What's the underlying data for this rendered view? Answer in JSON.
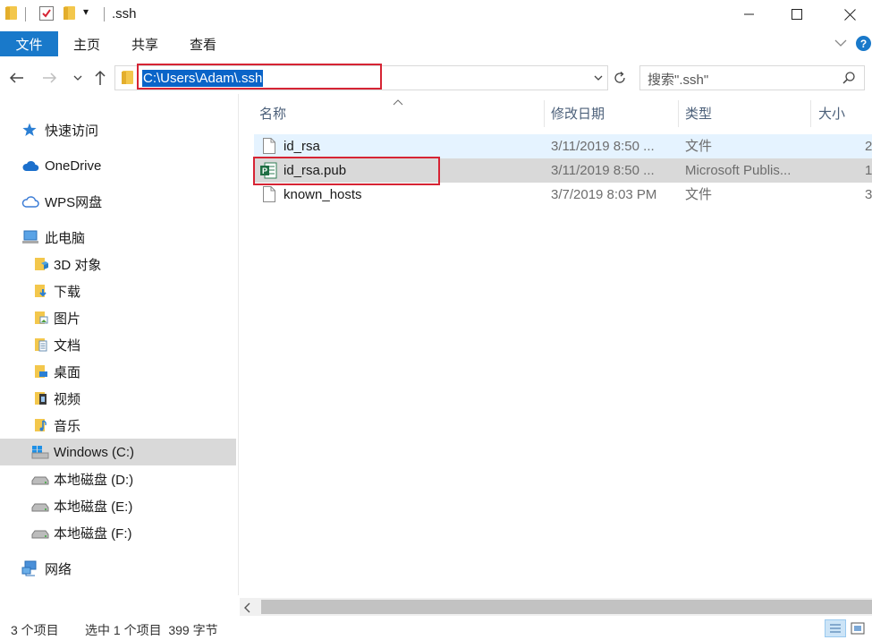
{
  "window": {
    "title": ".ssh",
    "qat_dropdown_glyph": "▾"
  },
  "ribbon": {
    "tabs": [
      {
        "label": "文件"
      },
      {
        "label": "主页"
      },
      {
        "label": "共享"
      },
      {
        "label": "查看"
      }
    ]
  },
  "address": {
    "path": "C:\\Users\\Adam\\.ssh",
    "search_placeholder": "搜索\".ssh\""
  },
  "nav": {
    "items": [
      {
        "label": "快速访问",
        "icon": "star-icon"
      },
      {
        "label": "OneDrive",
        "icon": "cloud-icon"
      },
      {
        "label": "WPS网盘",
        "icon": "cloud-outline-icon"
      },
      {
        "label": "此电脑",
        "icon": "computer-icon"
      },
      {
        "label": "3D 对象",
        "icon": "3d-objects-folder-icon"
      },
      {
        "label": "下载",
        "icon": "downloads-folder-icon"
      },
      {
        "label": "图片",
        "icon": "pictures-folder-icon"
      },
      {
        "label": "文档",
        "icon": "documents-folder-icon"
      },
      {
        "label": "桌面",
        "icon": "desktop-folder-icon"
      },
      {
        "label": "视频",
        "icon": "videos-folder-icon"
      },
      {
        "label": "音乐",
        "icon": "music-folder-icon"
      },
      {
        "label": "Windows (C:)",
        "icon": "windows-drive-icon"
      },
      {
        "label": "本地磁盘 (D:)",
        "icon": "drive-icon"
      },
      {
        "label": "本地磁盘 (E:)",
        "icon": "drive-icon"
      },
      {
        "label": "本地磁盘 (F:)",
        "icon": "drive-icon"
      },
      {
        "label": "网络",
        "icon": "network-icon"
      }
    ]
  },
  "columns": [
    "名称",
    "修改日期",
    "类型",
    "大小"
  ],
  "files": [
    {
      "name": "id_rsa",
      "modified": "3/11/2019 8:50 ...",
      "type": "文件",
      "size": "2"
    },
    {
      "name": "id_rsa.pub",
      "modified": "3/11/2019 8:50 ...",
      "type": "Microsoft Publis...",
      "size": "1"
    },
    {
      "name": "known_hosts",
      "modified": "3/7/2019 8:03 PM",
      "type": "文件",
      "size": "3"
    }
  ],
  "status": {
    "item_count": "3 个项目",
    "selection": "选中 1 个项目  399 字节"
  },
  "colors": {
    "accent": "#1979ca",
    "highlight_box": "#d62434",
    "selected_row": "#d9d9d9",
    "hover_row": "#e5f3ff"
  }
}
